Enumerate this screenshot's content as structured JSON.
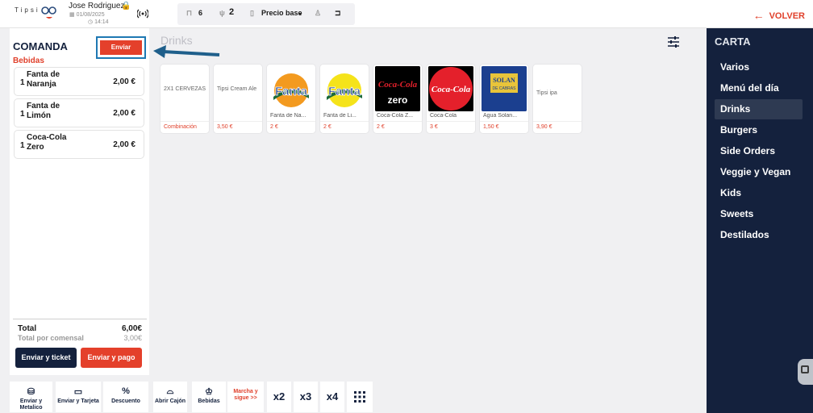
{
  "header": {
    "logo_text": "Tipsi",
    "user_name": "Jose Rodriguez",
    "date": "01/08/2025",
    "time": "14:14",
    "tables": "6",
    "guests": "2",
    "price_mode": "Precio base",
    "back_label": "VOLVER"
  },
  "comanda": {
    "title": "COMANDA",
    "send_label": "Enviar",
    "section": "Bebidas",
    "items": [
      {
        "qty": "1",
        "name": "Fanta de Naranja",
        "price": "2,00 €"
      },
      {
        "qty": "1",
        "name": "Fanta de Limón",
        "price": "2,00 €"
      },
      {
        "qty": "1",
        "name": "Coca-Cola Zero",
        "price": "2,00 €"
      }
    ],
    "total_label": "Total",
    "total_value": "6,00€",
    "per_guest_label": "Total por comensal",
    "per_guest_value": "3,00€",
    "btn_ticket": "Enviar y ticket",
    "btn_pay": "Enviar y pago"
  },
  "toolbar": {
    "cash": "Enviar y Metalico",
    "card": "Enviar y Tarjeta",
    "discount": "Descuento",
    "drawer": "Abrir Cajón",
    "drinks": "Bebidas",
    "march": "Marcha y sigue >>",
    "x2": "x2",
    "x3": "x3",
    "x4": "x4"
  },
  "products": {
    "title": "Drinks",
    "items": [
      {
        "name": "2X1 CERVEZAS",
        "label": "Combinación",
        "price": ""
      },
      {
        "name": "Tipsi Cream Ale",
        "label": "",
        "price": "3,50 €"
      },
      {
        "name": "",
        "label": "Fanta de Na...",
        "price": "2 €",
        "icon": "fanta-orange"
      },
      {
        "name": "",
        "label": "Fanta de Li...",
        "price": "2 €",
        "icon": "fanta-lemon"
      },
      {
        "name": "",
        "label": "Coca-Cola Z...",
        "price": "2 €",
        "icon": "coca-cola-zero"
      },
      {
        "name": "",
        "label": "Coca-Cola",
        "price": "3 €",
        "icon": "coca-cola"
      },
      {
        "name": "",
        "label": "Agua Solan...",
        "price": "1,50 €",
        "icon": "solan-de-cabras"
      },
      {
        "name": "Tipsi ipa",
        "label": "",
        "price": "3,90 €"
      }
    ]
  },
  "carta": {
    "title": "CARTA",
    "categories": [
      "Varios",
      "Menú del día",
      "Drinks",
      "Burgers",
      "Side Orders",
      "Veggie y Vegan",
      "Kids",
      "Sweets",
      "Destilados"
    ],
    "active": "Drinks"
  },
  "colors": {
    "accent": "#e4402b",
    "navy": "#14213d",
    "highlight": "#1e78b3"
  }
}
